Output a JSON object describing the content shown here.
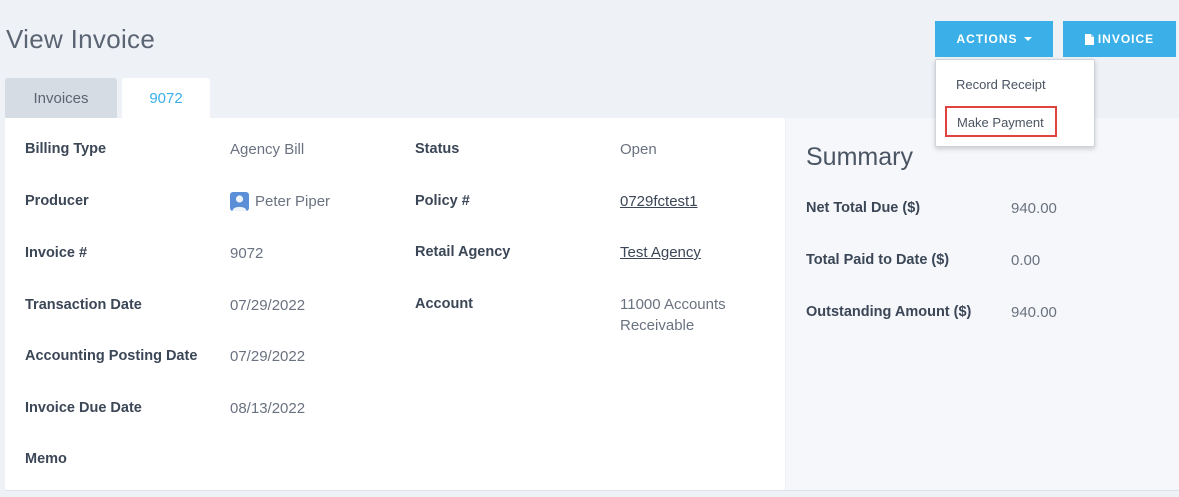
{
  "header": {
    "title": "View Invoice",
    "actions_label": "ACTIONS",
    "invoice_label": "INVOICE"
  },
  "actions_menu": {
    "items": [
      "Record Receipt",
      "Make Payment"
    ]
  },
  "tabs": [
    {
      "label": "Invoices"
    },
    {
      "label": "9072"
    }
  ],
  "details_left": [
    {
      "label": "Billing Type",
      "value": "Agency Bill"
    },
    {
      "label": "Producer",
      "value": "Peter Piper"
    },
    {
      "label": "Invoice #",
      "value": "9072"
    },
    {
      "label": "Transaction Date",
      "value": "07/29/2022"
    },
    {
      "label": "Accounting Posting Date",
      "value": "07/29/2022"
    },
    {
      "label": "Invoice Due Date",
      "value": "08/13/2022"
    },
    {
      "label": "Memo",
      "value": ""
    }
  ],
  "details_right": [
    {
      "label": "Status",
      "value": "Open"
    },
    {
      "label": "Policy #",
      "value": "0729fctest1"
    },
    {
      "label": "Retail Agency",
      "value": "Test Agency"
    },
    {
      "label": "Account",
      "value": "11000 Accounts Receivable"
    }
  ],
  "summary": {
    "title": "Summary",
    "rows": [
      {
        "label": "Net Total Due ($)",
        "value": "940.00"
      },
      {
        "label": "Total Paid to Date ($)",
        "value": "0.00"
      },
      {
        "label": "Outstanding Amount ($)",
        "value": "940.00"
      }
    ]
  },
  "colors": {
    "accent": "#3bb0e8",
    "highlight_border": "#e0423d",
    "background": "#eef1f6"
  }
}
